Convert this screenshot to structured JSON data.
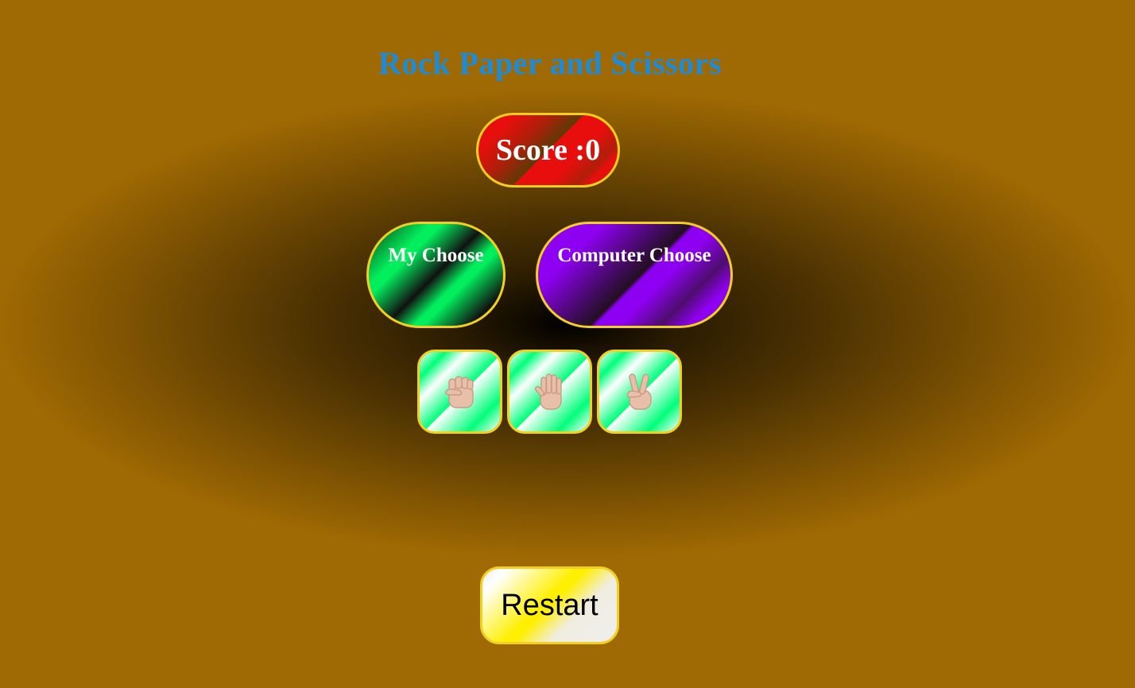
{
  "title": "Rock Paper and Scissors",
  "score": {
    "text": "Score :0"
  },
  "my_choice": {
    "label": "My Choose"
  },
  "computer_choice": {
    "label": "Computer Choose"
  },
  "options": [
    {
      "name": "rock",
      "icon": "raised-fist-icon"
    },
    {
      "name": "paper",
      "icon": "raised-hand-icon"
    },
    {
      "name": "scissors",
      "icon": "victory-hand-icon"
    }
  ],
  "restart": {
    "label": "Restart"
  },
  "colors": {
    "background": "#9f6903",
    "title": "#1e8bd8",
    "border": "#f3cf20",
    "score_red": "#e90e0e",
    "my_green": "#02ee5c",
    "computer_purple": "#8e00f2",
    "option_green": "#00ff7a",
    "restart_yellow": "#ffef00",
    "skin": "#e8bfa8"
  }
}
